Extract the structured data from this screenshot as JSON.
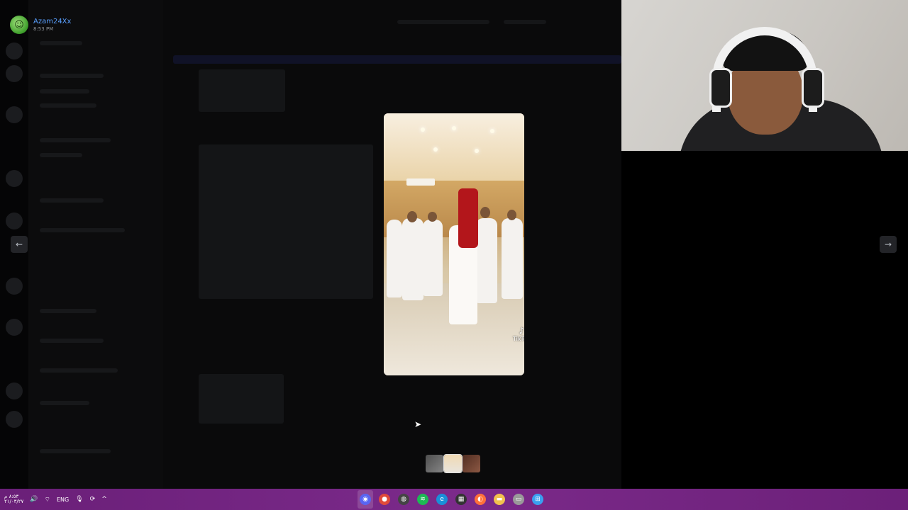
{
  "viewer": {
    "uploader_name": "Azam24Xx",
    "uploader_time": "8:53 PM",
    "avatar_glyph": "☺",
    "prev_icon": "←",
    "next_icon": "→"
  },
  "video": {
    "watermark_text": "TikTok",
    "watermark_icon": "♪"
  },
  "taskbar": {
    "clock_time": "٨:٥٣ م",
    "clock_date": "٢١/٠٣/٢٧",
    "language": "ENG",
    "icons": {
      "volume": "🔊",
      "wifi": "⌔",
      "mic": "🎙",
      "sync": "⟳",
      "chevron_up": "^"
    },
    "apps": [
      {
        "name": "Discord",
        "glyph": "◉",
        "color": "#5865f2"
      },
      {
        "name": "Chrome",
        "glyph": "●",
        "color": "#e04a3a"
      },
      {
        "name": "OBS",
        "glyph": "◍",
        "color": "#444444"
      },
      {
        "name": "Spotify",
        "glyph": "≋",
        "color": "#1db954"
      },
      {
        "name": "Edge",
        "glyph": "e",
        "color": "#1a8fd8"
      },
      {
        "name": "Clapper",
        "glyph": "▦",
        "color": "#333333"
      },
      {
        "name": "Firefox",
        "glyph": "◐",
        "color": "#ff7139"
      },
      {
        "name": "File Explorer",
        "glyph": "▬",
        "color": "#f2c14e"
      },
      {
        "name": "Window",
        "glyph": "▭",
        "color": "#9a9a9a"
      },
      {
        "name": "Start",
        "glyph": "⊞",
        "color": "#3aa0f0"
      }
    ]
  }
}
